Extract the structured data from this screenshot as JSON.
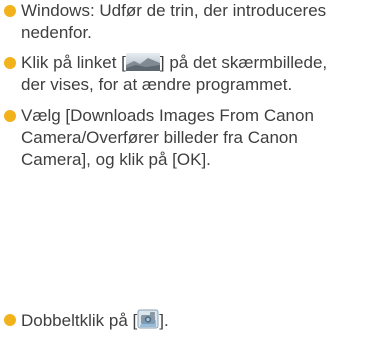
{
  "page": {
    "accent_color": "#f2b21b",
    "text_color": "#3f3f3f"
  },
  "bullets": [
    {
      "lines": [
        "Windows: Udfør de trin, der introduceres",
        "nedenfor."
      ]
    },
    {
      "line1_before": "Klik på linket [",
      "line1_after": "] på det skærmbillede,",
      "line2": "der vises, for at ændre programmet.",
      "icon": "landscape-photo-icon"
    },
    {
      "lines": [
        "Vælg [Downloads Images From Canon",
        "Camera/Overfører billeder fra Canon",
        "Camera], og klik på [OK]."
      ]
    },
    {
      "before": "Dobbeltklik på [",
      "after": "].",
      "icon": "camera-software-icon"
    }
  ]
}
